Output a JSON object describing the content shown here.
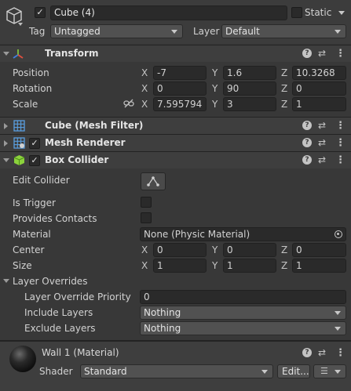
{
  "header": {
    "object_name": "Cube (4)",
    "active_checked": "✓",
    "static_label": "Static",
    "tag_label": "Tag",
    "tag_value": "Untagged",
    "layer_label": "Layer",
    "layer_value": "Default"
  },
  "transform": {
    "title": "Transform",
    "position": {
      "label": "Position",
      "x": "-7",
      "y": "1.6",
      "z": "10.3268"
    },
    "rotation": {
      "label": "Rotation",
      "x": "0",
      "y": "90",
      "z": "0"
    },
    "scale": {
      "label": "Scale",
      "x": "7.595794",
      "y": "3",
      "z": "1"
    }
  },
  "axes": {
    "x": "X",
    "y": "Y",
    "z": "Z"
  },
  "mesh_filter": {
    "title": "Cube (Mesh Filter)"
  },
  "mesh_renderer": {
    "title": "Mesh Renderer",
    "enabled": "✓"
  },
  "box_collider": {
    "title": "Box Collider",
    "enabled": "✓",
    "edit_collider_label": "Edit Collider",
    "is_trigger_label": "Is Trigger",
    "provides_contacts_label": "Provides Contacts",
    "material_label": "Material",
    "material_value": "None (Physic Material)",
    "center": {
      "label": "Center",
      "x": "0",
      "y": "0",
      "z": "0"
    },
    "size": {
      "label": "Size",
      "x": "1",
      "y": "1",
      "z": "1"
    },
    "layer_overrides_label": "Layer Overrides",
    "priority_label": "Layer Override Priority",
    "priority_value": "0",
    "include_label": "Include Layers",
    "include_value": "Nothing",
    "exclude_label": "Exclude Layers",
    "exclude_value": "Nothing"
  },
  "material": {
    "title": "Wall 1 (Material)",
    "shader_label": "Shader",
    "shader_value": "Standard",
    "edit_label": "Edit..."
  },
  "icons": {
    "help": "?",
    "presets": "⇄",
    "kebab": "⋮"
  }
}
